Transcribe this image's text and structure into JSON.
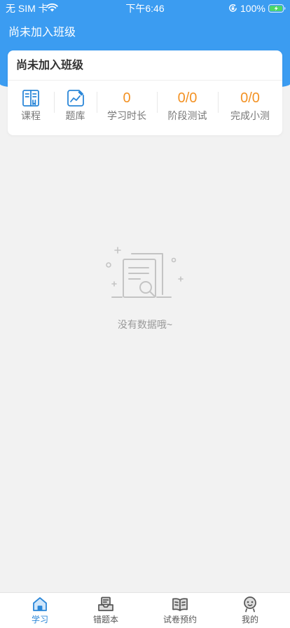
{
  "status_bar": {
    "carrier": "无 SIM 卡",
    "time": "下午6:46",
    "battery": "100%",
    "icons": [
      "wifi-icon",
      "rotation-lock-icon",
      "battery-charging-icon"
    ]
  },
  "header": {
    "title": "尚未加入班级"
  },
  "card": {
    "title": "尚未加入班级",
    "items": [
      {
        "icon": "book-icon",
        "label": "课程"
      },
      {
        "icon": "chart-icon",
        "label": "题库"
      },
      {
        "value": "0",
        "label": "学习时长"
      },
      {
        "value": "0/0",
        "label": "阶段测试"
      },
      {
        "value": "0/0",
        "label": "完成小测"
      }
    ]
  },
  "empty_state": {
    "icon": "empty-document-search-icon",
    "text": "没有数据哦~"
  },
  "tab_bar": {
    "active_index": 0,
    "tabs": [
      {
        "label": "学习",
        "icon": "home-icon"
      },
      {
        "label": "错题本",
        "icon": "inbox-tray-icon"
      },
      {
        "label": "试卷预约",
        "icon": "open-book-icon"
      },
      {
        "label": "我的",
        "icon": "profile-face-icon"
      }
    ]
  },
  "colors": {
    "primary": "#3b9cf1",
    "icon_blue": "#2b87d8",
    "accent_orange": "#f39224",
    "background": "#f2f2f2",
    "battery_green": "#4cd964"
  }
}
